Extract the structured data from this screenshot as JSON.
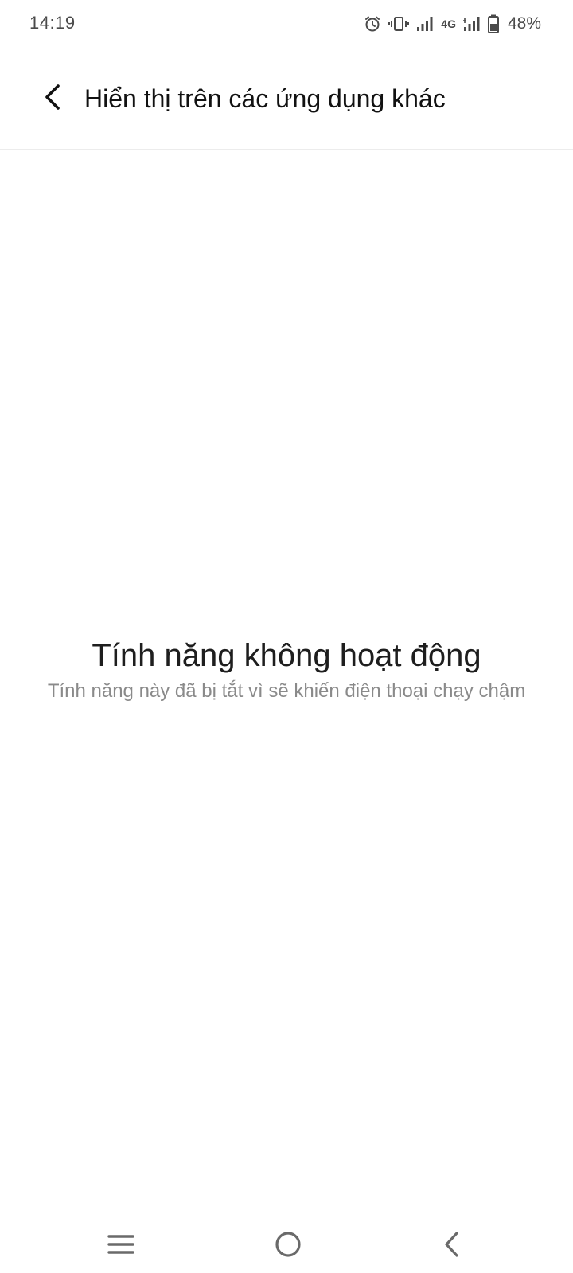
{
  "status_bar": {
    "time": "14:19",
    "network_label": "4G",
    "battery_percent": "48%",
    "icons": [
      "alarm-icon",
      "vibrate-icon",
      "signal-icon",
      "signal-icon",
      "battery-icon"
    ]
  },
  "header": {
    "title": "Hiển thị trên các ứng dụng khác",
    "back_icon": "chevron-left-icon"
  },
  "empty_state": {
    "title": "Tính năng không hoạt động",
    "description": "Tính năng này đã bị tắt vì sẽ khiến điện thoại chạy chậm"
  },
  "nav_bar": {
    "buttons": [
      "menu-icon",
      "home-icon",
      "back-icon"
    ]
  },
  "colors": {
    "background": "#ffffff",
    "title_text": "#111111",
    "secondary_text": "#8a8a8a",
    "icon_gray": "#4a4a4a"
  }
}
